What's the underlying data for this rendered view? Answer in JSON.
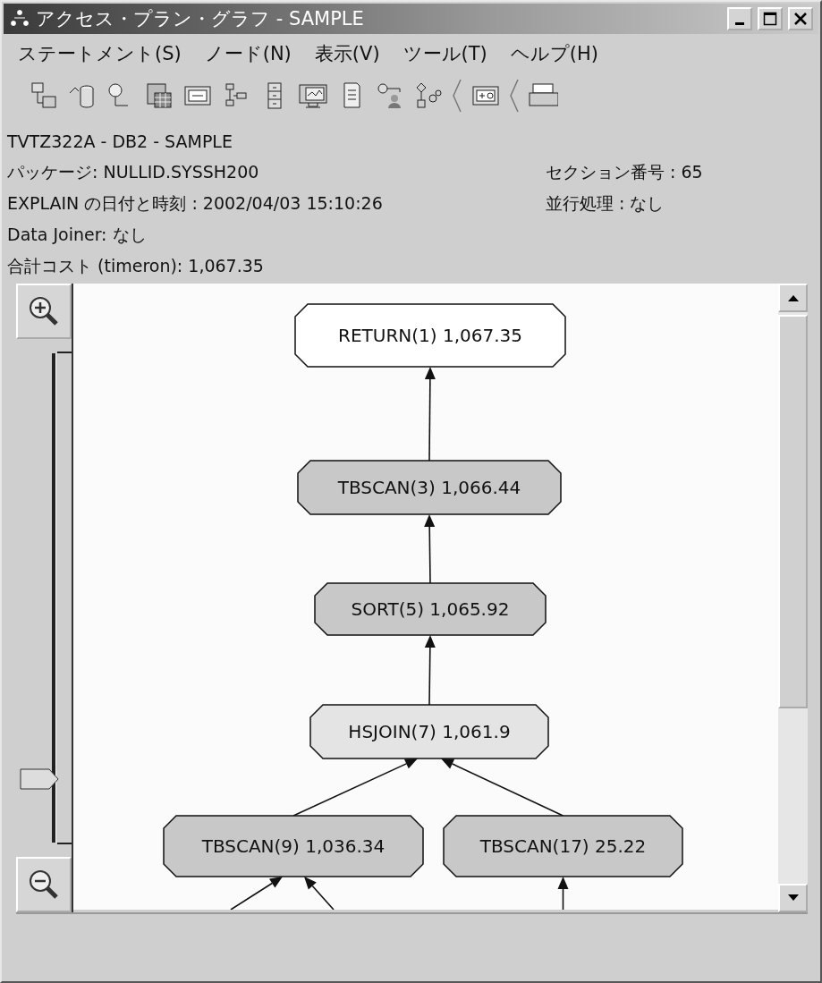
{
  "window": {
    "title": "アクセス・プラン・グラフ - SAMPLE"
  },
  "menu": [
    {
      "label": "ステートメント(S)"
    },
    {
      "label": "ノード(N)"
    },
    {
      "label": "表示(V)"
    },
    {
      "label": "ツール(T)"
    },
    {
      "label": "ヘルプ(H)"
    }
  ],
  "info": {
    "header": "TVTZ322A - DB2 - SAMPLE",
    "rows": [
      [
        "パッケージ: NULLID.SYSSH200",
        "セクション番号 : 65"
      ],
      [
        "EXPLAIN の日付と時刻 : 2002/04/03 15:10:26",
        "並行処理 : なし"
      ],
      [
        "Data Joiner: なし"
      ],
      [
        "合計コスト (timeron): 1,067.35"
      ]
    ]
  },
  "zoom": {
    "level": 0.13
  },
  "graph": {
    "root": {
      "label": "RETURN(1) 1,067.35",
      "color": "#ffffff",
      "children": [
        {
          "label": "TBSCAN(3) 1,066.44",
          "color": "#c8c8c8",
          "children": [
            {
              "label": "SORT(5) 1,065.92",
              "color": "#c8c8c8",
              "children": [
                {
                  "label": "HSJOIN(7) 1,061.9",
                  "color": "#e4e4e4",
                  "children": [
                    {
                      "label": "TBSCAN(9) 1,036.34",
                      "color": "#c8c8c8",
                      "cut_inputs": [
                        {
                          "kind": "left"
                        },
                        {
                          "kind": "right"
                        }
                      ]
                    },
                    {
                      "label": "TBSCAN(17) 25.22",
                      "color": "#c8c8c8",
                      "cut_inputs": [
                        {
                          "kind": "below"
                        }
                      ]
                    }
                  ]
                }
              ]
            }
          ]
        }
      ]
    }
  }
}
